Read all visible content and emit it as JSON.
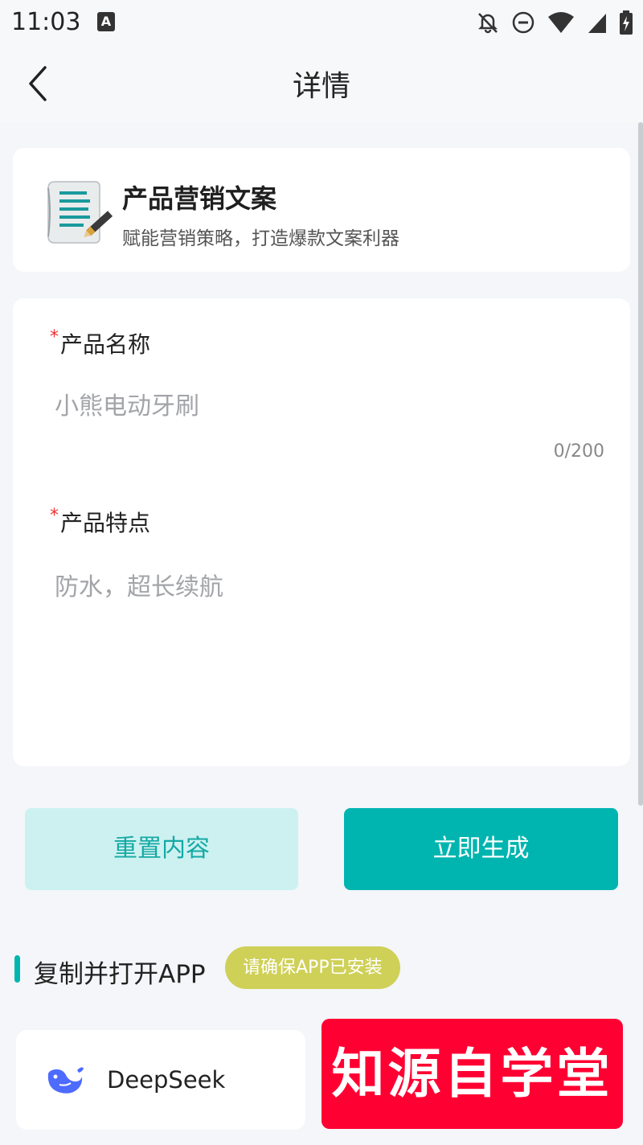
{
  "status_bar": {
    "time": "11:03",
    "app_badge": "A"
  },
  "nav": {
    "title": "详情"
  },
  "intro": {
    "title": "产品营销文案",
    "subtitle": "赋能营销策略，打造爆款文案利器"
  },
  "form": {
    "required_mark": "*",
    "product_name": {
      "label": "产品名称",
      "value": "",
      "placeholder": "小熊电动牙刷",
      "counter": "0/200"
    },
    "product_features": {
      "label": "产品特点",
      "value": "",
      "placeholder": "防水，超长续航"
    }
  },
  "actions": {
    "reset_label": "重置内容",
    "generate_label": "立即生成"
  },
  "open_app": {
    "title": "复制并打开APP",
    "badge": "请确保APP已安装",
    "apps": [
      {
        "name": "DeepSeek"
      }
    ]
  },
  "watermark": {
    "text": "知源自学堂"
  },
  "colors": {
    "accent": "#00b5b0",
    "accent_light": "#cdf1f1",
    "badge": "#cfd057",
    "required": "#e33333",
    "watermark_bg": "#ff0033"
  }
}
